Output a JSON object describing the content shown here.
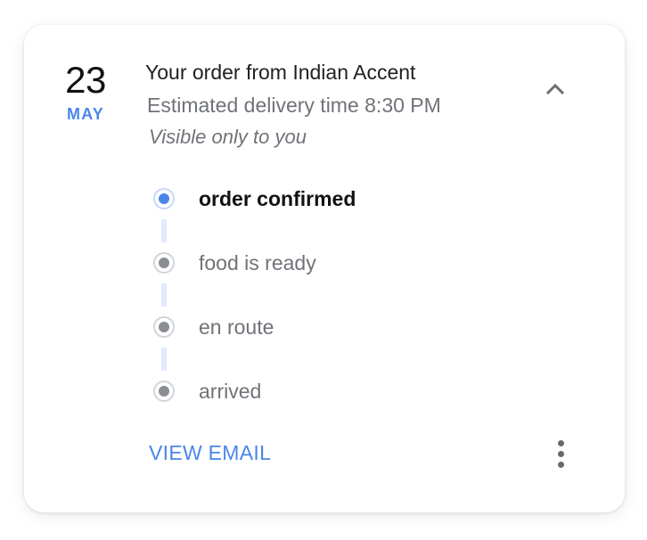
{
  "date": {
    "day": "23",
    "month": "MAY"
  },
  "order": {
    "title": "Your order from Indian Accent",
    "estimated_delivery": "Estimated delivery time 8:30 PM",
    "visibility": "Visible only to you"
  },
  "steps": [
    {
      "label": "order confirmed",
      "state": "active"
    },
    {
      "label": "food is ready",
      "state": "pending"
    },
    {
      "label": "en route",
      "state": "pending"
    },
    {
      "label": "arrived",
      "state": "pending"
    }
  ],
  "actions": {
    "view_email_label": "VIEW EMAIL"
  },
  "icons": {
    "collapse": "chevron-up-icon",
    "more": "more-vert-icon"
  },
  "colors": {
    "accent": "#4a86e8",
    "active_step_core": "#4a86e8",
    "pending_step_core": "#8a8d91",
    "connector": "#e1ebfb"
  }
}
